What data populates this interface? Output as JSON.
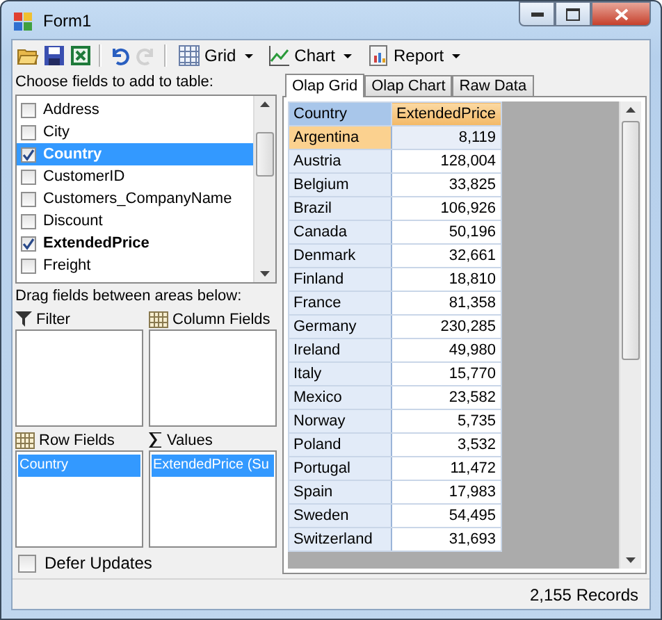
{
  "window": {
    "title": "Form1"
  },
  "toolbar": {
    "items": [
      {
        "kind": "icon",
        "disabled": false
      },
      {
        "kind": "icon",
        "disabled": false
      },
      {
        "kind": "icon",
        "disabled": false
      },
      {
        "kind": "separator"
      },
      {
        "kind": "icon",
        "disabled": false
      },
      {
        "kind": "icon",
        "disabled": true
      },
      {
        "kind": "separator"
      },
      {
        "kind": "dropdown",
        "label": "Grid"
      },
      {
        "kind": "dropdown",
        "label": "Chart"
      },
      {
        "kind": "dropdown",
        "label": "Report"
      }
    ]
  },
  "field_list": {
    "label": "Choose fields to add to table:",
    "items": [
      {
        "label": "Address",
        "checked": false,
        "selected": false
      },
      {
        "label": "City",
        "checked": false,
        "selected": false
      },
      {
        "label": "Country",
        "checked": true,
        "selected": true
      },
      {
        "label": "CustomerID",
        "checked": false,
        "selected": false
      },
      {
        "label": "Customers_CompanyName",
        "checked": false,
        "selected": false
      },
      {
        "label": "Discount",
        "checked": false,
        "selected": false
      },
      {
        "label": "ExtendedPrice",
        "checked": true,
        "selected": false
      },
      {
        "label": "Freight",
        "checked": false,
        "selected": false
      }
    ]
  },
  "areas_label": "Drag fields between areas below:",
  "areas": [
    {
      "kind": "filter",
      "label": "Filter"
    },
    {
      "kind": "columns",
      "label": "Column Fields"
    },
    {
      "kind": "rows",
      "label": "Row Fields",
      "items": [
        {
          "label": "Country",
          "selected": true
        }
      ]
    },
    {
      "kind": "values",
      "label": "Values",
      "items": [
        {
          "label": "ExtendedPrice (Su",
          "selected": true
        }
      ]
    }
  ],
  "defer_updates": {
    "label": "Defer Updates",
    "checked": false
  },
  "tabs": [
    {
      "label": "Olap Grid",
      "selected": true
    },
    {
      "label": "Olap Chart",
      "selected": false
    },
    {
      "label": "Raw Data",
      "selected": false
    }
  ],
  "grid": {
    "columns": [
      "Country",
      "ExtendedPrice"
    ],
    "rows": [
      {
        "country": "Argentina",
        "value": "8,119",
        "selected": true
      },
      {
        "country": "Austria",
        "value": "128,004",
        "selected": false
      },
      {
        "country": "Belgium",
        "value": "33,825",
        "selected": false
      },
      {
        "country": "Brazil",
        "value": "106,926",
        "selected": false
      },
      {
        "country": "Canada",
        "value": "50,196",
        "selected": false
      },
      {
        "country": "Denmark",
        "value": "32,661",
        "selected": false
      },
      {
        "country": "Finland",
        "value": "18,810",
        "selected": false
      },
      {
        "country": "France",
        "value": "81,358",
        "selected": false
      },
      {
        "country": "Germany",
        "value": "230,285",
        "selected": false
      },
      {
        "country": "Ireland",
        "value": "49,980",
        "selected": false
      },
      {
        "country": "Italy",
        "value": "15,770",
        "selected": false
      },
      {
        "country": "Mexico",
        "value": "23,582",
        "selected": false
      },
      {
        "country": "Norway",
        "value": "5,735",
        "selected": false
      },
      {
        "country": "Poland",
        "value": "3,532",
        "selected": false
      },
      {
        "country": "Portugal",
        "value": "11,472",
        "selected": false
      },
      {
        "country": "Spain",
        "value": "17,983",
        "selected": false
      },
      {
        "country": "Sweden",
        "value": "54,495",
        "selected": false
      },
      {
        "country": "Switzerland",
        "value": "31,693",
        "selected": false
      }
    ]
  },
  "status_bar": {
    "text": "2,155 Records"
  }
}
